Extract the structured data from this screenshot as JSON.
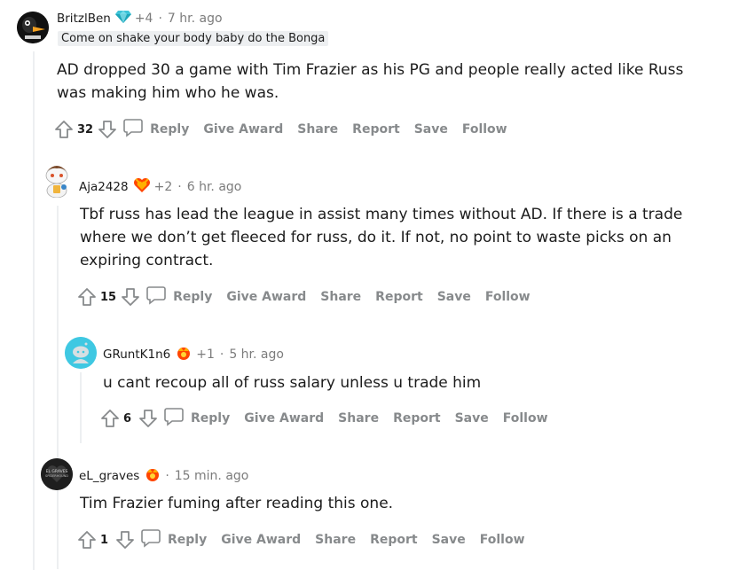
{
  "colors": {
    "text": "#1c1c1c",
    "muted": "#878a8c",
    "line": "#edeff1",
    "upvote": "#878a8c"
  },
  "actions": {
    "reply": "Reply",
    "give_award": "Give Award",
    "share": "Share",
    "report": "Report",
    "save": "Save",
    "follow": "Follow"
  },
  "comments": [
    {
      "username": "BritzlBen",
      "award_icon": "diamond-award-icon",
      "award_count": "+4",
      "separator": "·",
      "time": "7 hr. ago",
      "flair": "Come on shake your body baby do the Bonga",
      "body": "AD dropped 30 a game with Tim Frazier as his PG and people really acted like Russ was making him who he was.",
      "score": "32"
    },
    {
      "username": "Aja2428",
      "award_icon": "heart-award-icon",
      "award_count": "+2",
      "separator": "·",
      "time": "6 hr. ago",
      "body": "Tbf russ has lead the league in assist many times without AD. If there is a trade where we don’t get fleeced for russ, do it. If not, no point to waste picks on an expiring contract.",
      "score": "15"
    },
    {
      "username": "GRuntK1n6",
      "award_icon": "crown-award-icon",
      "award_count": "+1",
      "separator": "·",
      "time": "5 hr. ago",
      "body": "u cant recoup all of russ salary unless u trade him",
      "score": "6"
    },
    {
      "username": "eL_graves",
      "award_icon": "crown-award-icon",
      "separator": "·",
      "time": "15 min. ago",
      "body": "Tim Frazier fuming after reading this one.",
      "score": "1"
    }
  ]
}
